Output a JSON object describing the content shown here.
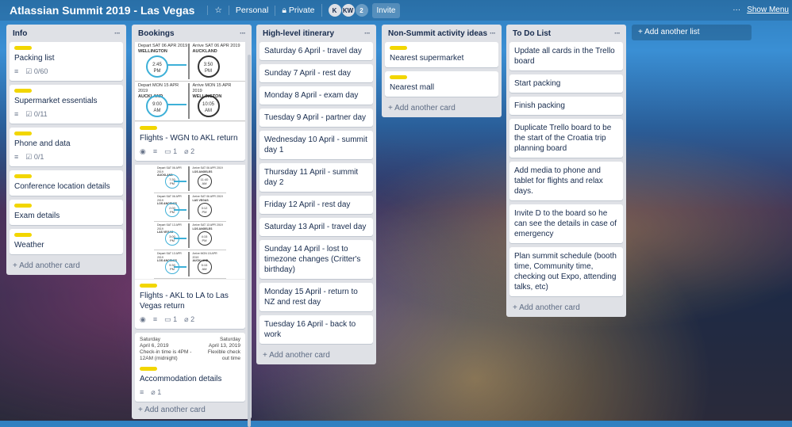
{
  "header": {
    "title": "Atlassian Summit 2019 - Las Vegas",
    "star_icon": "star-icon",
    "team": "Personal",
    "visibility": "Private",
    "members": [
      "K",
      "KW"
    ],
    "member_count": "2",
    "invite": "Invite",
    "show_menu": "Show Menu",
    "more": "···"
  },
  "add_list": "+ Add another list",
  "add_card": "+ Add another card",
  "lists": [
    {
      "title": "Info",
      "cards": [
        {
          "label": true,
          "title": "Packing list",
          "desc": true,
          "checklist": "0/60"
        },
        {
          "label": true,
          "title": "Supermarket essentials",
          "desc": true,
          "checklist": "0/11"
        },
        {
          "label": true,
          "title": "Phone and data",
          "desc": true,
          "checklist": "0/1"
        },
        {
          "label": true,
          "title": "Conference location details"
        },
        {
          "label": true,
          "title": "Exam details"
        },
        {
          "label": true,
          "title": "Weather"
        }
      ]
    },
    {
      "title": "Bookings",
      "cards": [
        {
          "cover": "flights1",
          "label": true,
          "title": "Flights - WGN to AKL return",
          "watch": true,
          "desc": true,
          "comments": "1",
          "attachments": "2"
        },
        {
          "cover": "flights2",
          "label": true,
          "title": "Flights - AKL to LA to Las Vegas return",
          "watch": true,
          "desc": true,
          "comments": "1",
          "attachments": "2"
        },
        {
          "cover": "acc",
          "label": true,
          "title": "Accommodation details",
          "desc": true,
          "attachments": "1"
        },
        {
          "label": true,
          "title": "Insurance and visa details"
        }
      ]
    },
    {
      "title": "High-level itinerary",
      "cards": [
        {
          "title": "Saturday 6 April - travel day"
        },
        {
          "title": "Sunday 7 April - rest day"
        },
        {
          "title": "Monday 8 April - exam day"
        },
        {
          "title": "Tuesday 9 April - partner day"
        },
        {
          "title": "Wednesday 10 April - summit day 1"
        },
        {
          "title": "Thursday 11 April - summit day 2"
        },
        {
          "title": "Friday 12 April - rest day"
        },
        {
          "title": "Saturday 13 April - travel day"
        },
        {
          "title": "Sunday 14 April - lost to timezone changes (Critter's birthday)"
        },
        {
          "title": "Monday 15 April - return to NZ and rest day"
        },
        {
          "title": "Tuesday 16 April - back to work"
        }
      ]
    },
    {
      "title": "Non-Summit activity ideas",
      "cards": [
        {
          "label": true,
          "title": "Nearest supermarket"
        },
        {
          "label": true,
          "title": "Nearest mall"
        }
      ]
    },
    {
      "title": "To Do List",
      "cards": [
        {
          "title": "Update all cards in the Trello board"
        },
        {
          "title": "Start packing"
        },
        {
          "title": "Finish packing"
        },
        {
          "title": "Duplicate Trello board to be the start of the Croatia trip planning board"
        },
        {
          "title": "Add media to phone and tablet for flights and relax days."
        },
        {
          "title": "Invite D to the board so he can see the details in case of emergency"
        },
        {
          "title": "Plan summit schedule (booth time, Community time, checking out Expo, attending talks, etc)"
        }
      ]
    }
  ],
  "covers": {
    "flights1": [
      {
        "dep": "Depart SAT 06 APR 2019",
        "from": "WELLINGTON",
        "dt": "2:45",
        "dp": "PM",
        "arr": "Arrive SAT 06 APR 2019",
        "to": "AUCKLAND",
        "at": "3:50",
        "ap": "PM"
      },
      {
        "dep": "Depart MON 15 APR 2019",
        "from": "AUCKLAND",
        "dt": "9:00",
        "dp": "AM",
        "arr": "Arrive MON 15 APR 2019",
        "to": "WELLINGTON",
        "at": "10:05",
        "ap": "AM"
      }
    ],
    "flights2": [
      {
        "dep": "Depart SAT 06 APR 2019",
        "from": "AUCKLAND",
        "dt": "7:30",
        "dp": "PM",
        "arr": "Arrive SAT 06 APR 2019",
        "to": "LOS ANGELES",
        "at": "11:40",
        "ap": "AM"
      },
      {
        "dep": "Depart SAT 06 APR 2019",
        "from": "LOS ANGELES",
        "dt": "2:00",
        "dp": "PM",
        "arr": "Arrive SAT 06 APR 2019",
        "to": "LAS VEGAS",
        "at": "3:12",
        "ap": "PM"
      },
      {
        "dep": "Depart SAT 13 APR 2019",
        "from": "LAS VEGAS",
        "dt": "3:00",
        "dp": "PM",
        "arr": "Arrive SAT 13 APR 2019",
        "to": "LOS ANGELES",
        "at": "4:15",
        "ap": "PM"
      },
      {
        "dep": "Depart SAT 13 APR 2019",
        "from": "LOS ANGELES",
        "dt": "9:30",
        "dp": "PM",
        "arr": "Arrive MON 15 APR 2019",
        "to": "AUCKLAND",
        "at": "5:15",
        "ap": "AM"
      }
    ],
    "acc": {
      "left": [
        "Saturday",
        "April 6, 2019",
        "Check-in time is 4PM - 12AM (midnight)"
      ],
      "right": [
        "Saturday",
        "April 13, 2019",
        "Flexible check out time"
      ]
    }
  }
}
